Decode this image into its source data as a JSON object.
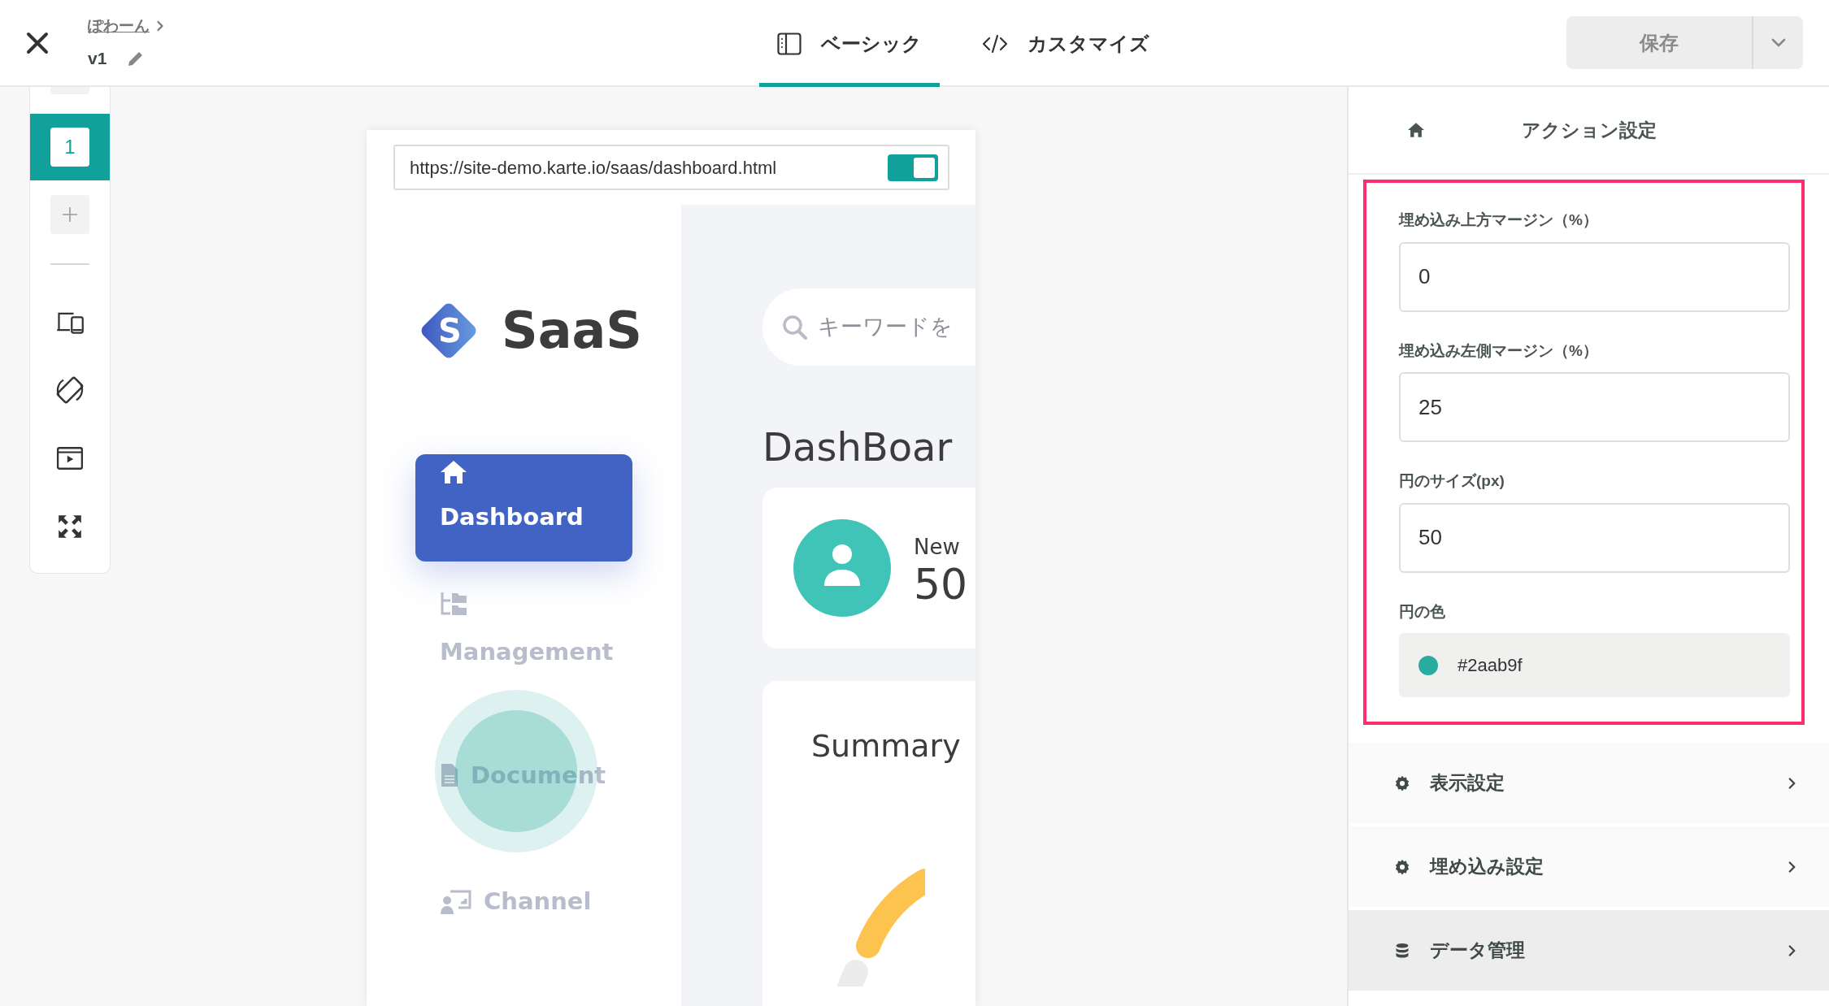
{
  "header": {
    "breadcrumb": "ぽわーん",
    "version": "v1",
    "tabs": [
      {
        "label": "ベーシック",
        "kind": "layout",
        "selected": true
      },
      {
        "label": "カスタマイズ",
        "kind": "code",
        "selected": false
      }
    ],
    "save_button": {
      "label": "保存",
      "disabled": true
    }
  },
  "toolbar": {
    "pages": [
      {
        "label": "1",
        "selected": true
      }
    ]
  },
  "preview": {
    "url": "https://site-demo.karte.io/saas/dashboard.html",
    "url_toggle_on": true,
    "site": {
      "logo_letter": "S",
      "brand": "SaaS",
      "search_placeholder": "キーワードを",
      "nav": [
        {
          "label": "Dashboard",
          "kind": "home",
          "selected": true
        },
        {
          "label": "Management",
          "kind": "folders",
          "selected": false
        },
        {
          "label": "Document",
          "kind": "document",
          "selected": false
        },
        {
          "label": "Channel",
          "kind": "channel",
          "selected": false
        }
      ],
      "heading": "DashBoar",
      "stat": {
        "label": "New",
        "value": "50"
      },
      "summary_title": "Summary"
    }
  },
  "panel": {
    "title": "アクション設定",
    "fields": [
      {
        "label": "埋め込み上方マージン（%）",
        "value": "0"
      },
      {
        "label": "埋め込み左側マージン（%）",
        "value": "25"
      },
      {
        "label": "円のサイズ(px)",
        "value": "50"
      }
    ],
    "color_field": {
      "label": "円の色",
      "value": "#2aab9f",
      "color": "#2aab9f"
    },
    "sections": [
      {
        "label": "表示設定",
        "kind": "gear",
        "selected": false
      },
      {
        "label": "埋め込み設定",
        "kind": "gear",
        "selected": false
      },
      {
        "label": "データ管理",
        "kind": "database",
        "selected": true
      }
    ]
  }
}
